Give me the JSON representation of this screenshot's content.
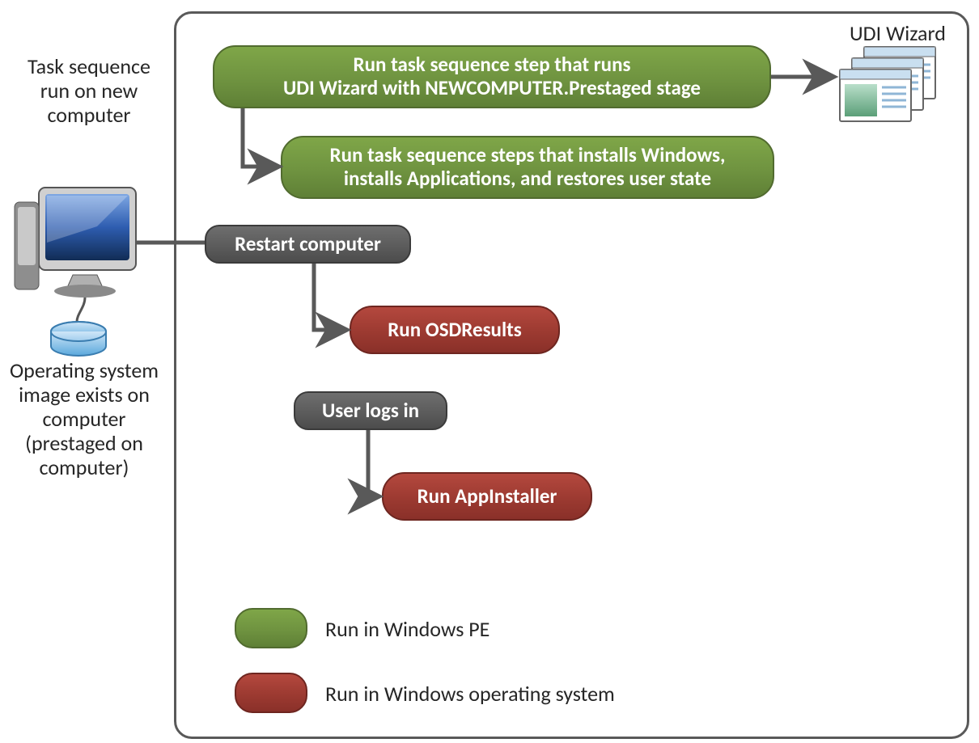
{
  "labels": {
    "udi_wizard": "UDI Wizard",
    "left_top": "Task sequence run on new computer",
    "left_bottom": "Operating system image exists on computer (prestaged on computer)"
  },
  "nodes": {
    "step1_line1": "Run task sequence step  that runs",
    "step1_line2": "UDI Wizard with NEWCOMPUTER.Prestaged  stage",
    "step2_line1": "Run task sequence steps that installs Windows,",
    "step2_line2": "installs Applications, and restores user state",
    "restart": "Restart computer",
    "osd": "Run OSDResults",
    "userlogs": "User logs in",
    "appinstaller": "Run AppInstaller"
  },
  "legend": {
    "pe": "Run in Windows  PE",
    "os": "Run in Windows operating system"
  }
}
